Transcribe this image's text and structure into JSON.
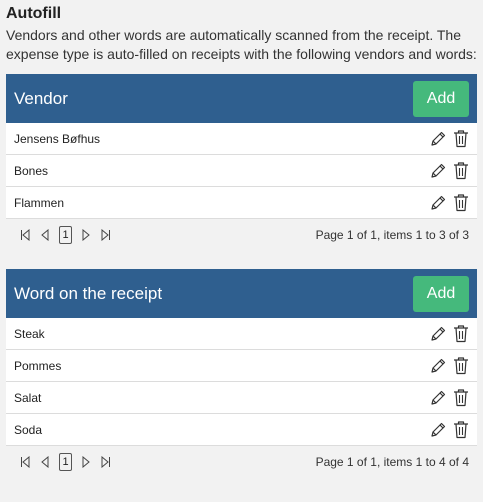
{
  "autofill": {
    "heading": "Autofill",
    "description": "Vendors and other words are automatically scanned from the receipt. The expense type is auto-filled on receipts with the following vendors and words:"
  },
  "vendors": {
    "title": "Vendor",
    "add_label": "Add",
    "rows": [
      "Jensens Bøfhus",
      "Bones",
      "Flammen"
    ],
    "pager": {
      "page": "1",
      "summary": "Page 1 of 1, items 1 to 3 of 3"
    }
  },
  "words": {
    "title": "Word on the receipt",
    "add_label": "Add",
    "rows": [
      "Steak",
      "Pommes",
      "Salat",
      "Soda"
    ],
    "pager": {
      "page": "1",
      "summary": "Page 1 of 1, items 1 to 4 of 4"
    }
  },
  "icons": {
    "edit": "pencil-icon",
    "delete": "trash-icon",
    "first": "first-page-icon",
    "prev": "prev-page-icon",
    "next": "next-page-icon",
    "last": "last-page-icon"
  },
  "colors": {
    "header_bg": "#2f5f8f",
    "add_button": "#45b97c",
    "page_bg": "#f2f2f2"
  }
}
